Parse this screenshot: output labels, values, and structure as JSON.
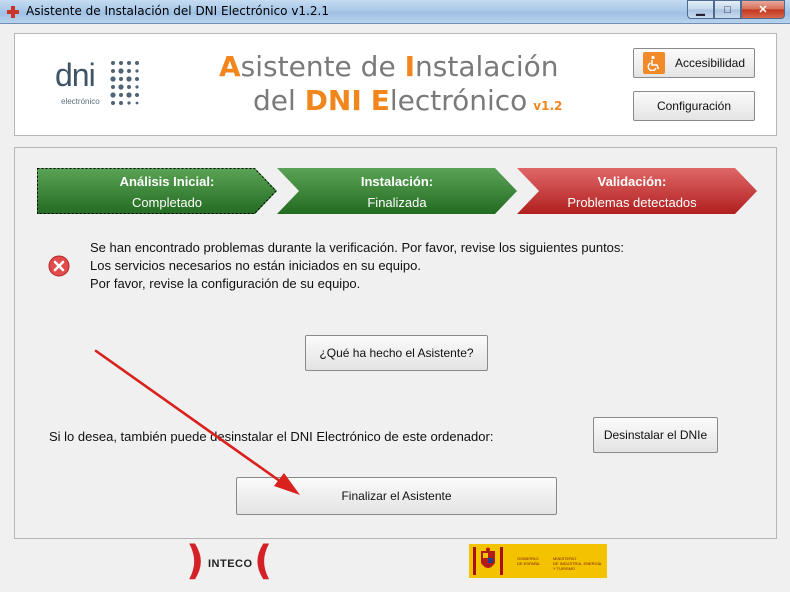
{
  "window": {
    "title": "Asistente de Instalación del DNI Electrónico v1.2.1",
    "minimize_glyph": "▁",
    "maximize_glyph": "□",
    "close_glyph": "✕"
  },
  "header": {
    "logo_word": "dni",
    "logo_sub": "electrónico",
    "title_line1": [
      "A",
      "sistente de ",
      "I",
      "nstalación"
    ],
    "title_line2": [
      "del ",
      "DNI",
      " ",
      "E",
      "lectrónico"
    ],
    "version": "v1.2",
    "accessibility_label": "Accesibilidad",
    "config_label": "Configuración",
    "accent_color": "#f0861c"
  },
  "steps": [
    {
      "title": "Análisis Inicial:",
      "status": "Completado",
      "color": "#2f7a2c"
    },
    {
      "title": "Instalación:",
      "status": "Finalizada",
      "color": "#2f7a2c"
    },
    {
      "title": "Validación:",
      "status": "Problemas detectados",
      "color": "#c62b2b"
    }
  ],
  "messages": [
    "Se han encontrado problemas durante la verificación. Por favor, revise los siguientes puntos:",
    "Los servicios necesarios no están iniciados en su equipo.",
    "Por favor, revise la configuración de su equipo."
  ],
  "buttons": {
    "what_done": "¿Qué ha hecho el Asistente?",
    "uninstall": "Desinstalar el DNIe",
    "finish": "Finalizar el Asistente"
  },
  "uninstall_prompt": "Si lo desea, también puede desinstalar el DNI Electrónico de este ordenador:",
  "footer": {
    "inteco_word": "INTECO",
    "gov_line1": "GOBIERNO\nDE ESPAÑA",
    "gov_line2": "MINISTERIO\nDE INDUSTRIA, ENERGÍA\nY TURISMO"
  },
  "icons": {
    "app": "dni-app-icon",
    "error": "error-icon",
    "accessibility": "wheelchair-icon",
    "annotation": "red-arrow-annotation"
  }
}
